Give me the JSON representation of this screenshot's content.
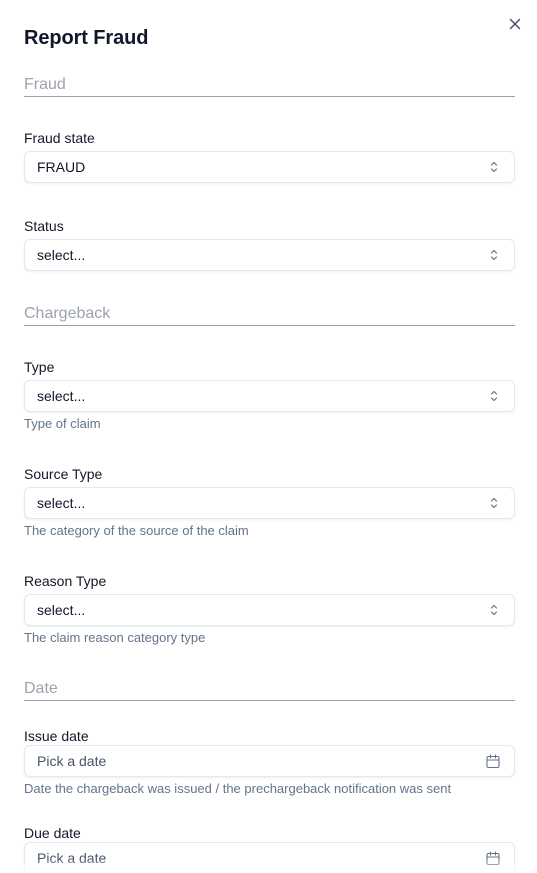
{
  "dialog": {
    "title": "Report Fraud",
    "close_icon": "close-icon"
  },
  "sections": {
    "fraud": "Fraud",
    "chargeback": "Chargeback",
    "date": "Date"
  },
  "fields": {
    "fraud_state": {
      "label": "Fraud state",
      "value": "FRAUD"
    },
    "status": {
      "label": "Status",
      "value": "select..."
    },
    "type": {
      "label": "Type",
      "value": "select...",
      "help": "Type of claim"
    },
    "source_type": {
      "label": "Source Type",
      "value": "select...",
      "help": "The category of the source of the claim"
    },
    "reason_type": {
      "label": "Reason Type",
      "value": "select...",
      "help": "The claim reason category type"
    },
    "issue_date": {
      "label": "Issue date",
      "placeholder": "Pick a date",
      "help": "Date the chargeback was issued / the prechargeback notification was sent"
    },
    "due_date": {
      "label": "Due date",
      "placeholder": "Pick a date"
    }
  },
  "icons": {
    "select": "chevron-up-down-icon",
    "date": "calendar-icon"
  }
}
